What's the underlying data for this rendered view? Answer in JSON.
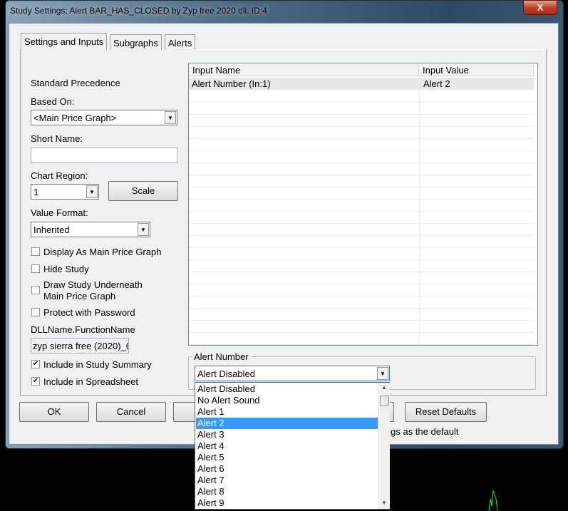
{
  "window": {
    "title": "Study Settings: Alert BAR_HAS_CLOSED by Zyp free 2020 dll. ID:4",
    "close_label": "X"
  },
  "tabs": [
    "Settings and Inputs",
    "Subgraphs",
    "Alerts"
  ],
  "left": {
    "standard_precedence": "Standard Precedence",
    "based_on_label": "Based On:",
    "based_on_value": "<Main Price Graph>",
    "short_name_label": "Short Name:",
    "short_name_value": "",
    "chart_region_label": "Chart Region:",
    "chart_region_value": "1",
    "scale_label": "Scale",
    "value_format_label": "Value Format:",
    "value_format_value": "Inherited",
    "checkboxes": [
      {
        "label": "Display As Main Price Graph",
        "checked": false
      },
      {
        "label": "Hide Study",
        "checked": false
      },
      {
        "label": "Draw Study Underneath Main Price Graph",
        "checked": false
      },
      {
        "label": "Protect with Password",
        "checked": false
      }
    ],
    "dll_label": "DLLName.FunctionName",
    "dll_value": "zyp sierra free (2020)_6",
    "include_summary": {
      "label": "Include in Study Summary",
      "checked": true
    },
    "include_spreadsheet": {
      "label": "Include in Spreadsheet",
      "checked": true
    }
  },
  "table": {
    "headers": [
      "Input Name",
      "Input Value"
    ],
    "rows": [
      {
        "name": "Alert Number   (In:1)",
        "value": "Alert 2"
      }
    ]
  },
  "alert_group": {
    "label": "Alert Number",
    "value": "Alert Disabled"
  },
  "dropdown": {
    "options": [
      "Alert Disabled",
      "No Alert Sound",
      "Alert 1",
      "Alert 2",
      "Alert 3",
      "Alert 4",
      "Alert 5",
      "Alert 6",
      "Alert 7",
      "Alert 8",
      "Alert 9"
    ],
    "selected": "Alert 2"
  },
  "buttons": {
    "ok": "OK",
    "cancel": "Cancel",
    "reset": "Reset Defaults"
  },
  "default_text": "ings as the default"
}
